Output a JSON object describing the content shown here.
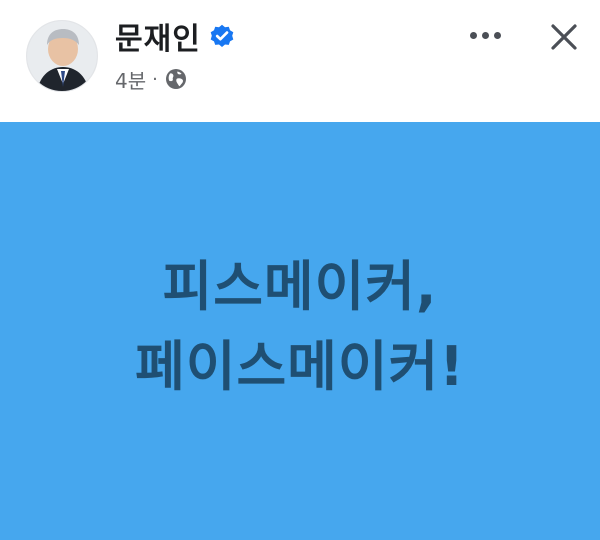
{
  "post": {
    "author": "문재인",
    "time": "4분",
    "separator": "·",
    "privacy_icon": "globe-icon",
    "verified_icon": "verified-badge-icon",
    "more_icon": "more-options-icon",
    "close_icon": "close-icon",
    "card": {
      "line1": "피스메이커,",
      "line2": "페이스메이커!",
      "background_color": "#46a7ee",
      "text_color": "#1f4f73"
    }
  }
}
